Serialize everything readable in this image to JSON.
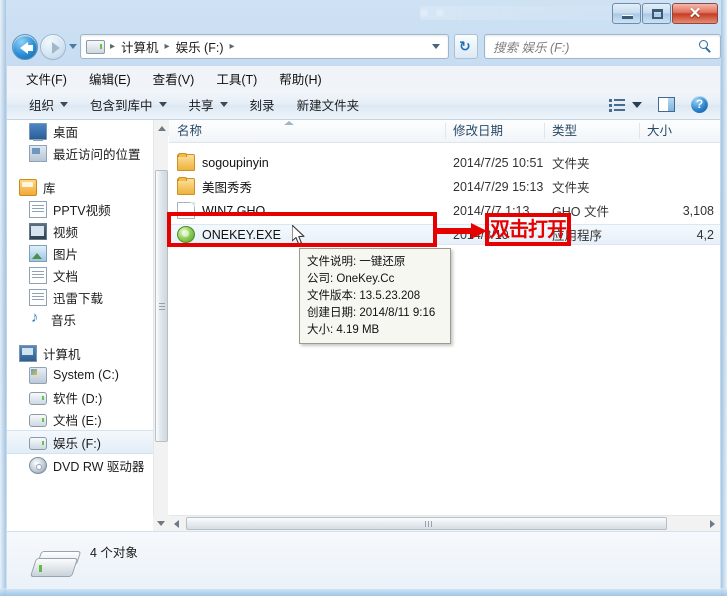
{
  "window": {
    "controls": {
      "minimize": "–",
      "maximize": "□",
      "close": "✕"
    }
  },
  "addressbar": {
    "crumbs": [
      "计算机",
      "娱乐 (F:)"
    ],
    "separator": "▸",
    "refresh_label": "↻"
  },
  "search": {
    "placeholder": "搜索 娱乐 (F:)"
  },
  "menubar": {
    "items": [
      {
        "label": "文件(F)"
      },
      {
        "label": "编辑(E)"
      },
      {
        "label": "查看(V)"
      },
      {
        "label": "工具(T)"
      },
      {
        "label": "帮助(H)"
      }
    ]
  },
  "toolbar": {
    "items": [
      {
        "label": "组织",
        "caret": true
      },
      {
        "label": "包含到库中",
        "caret": true
      },
      {
        "label": "共享",
        "caret": true
      },
      {
        "label": "刻录",
        "caret": false
      },
      {
        "label": "新建文件夹",
        "caret": false
      }
    ],
    "help_label": "?"
  },
  "navpane": {
    "items": [
      {
        "label": "桌面",
        "icon": "desktop-icon",
        "indent": true,
        "selected": false
      },
      {
        "label": "最近访问的位置",
        "icon": "recent-places-icon",
        "indent": true,
        "selected": false
      },
      {
        "label": "",
        "icon": "spacer",
        "indent": false,
        "selected": false
      },
      {
        "label": "库",
        "icon": "library-icon",
        "indent": false,
        "selected": false
      },
      {
        "label": "PPTV视频",
        "icon": "pptv-icon",
        "indent": true,
        "selected": false
      },
      {
        "label": "视频",
        "icon": "video-icon",
        "indent": true,
        "selected": false
      },
      {
        "label": "图片",
        "icon": "pictures-icon",
        "indent": true,
        "selected": false
      },
      {
        "label": "文档",
        "icon": "documents-icon",
        "indent": true,
        "selected": false
      },
      {
        "label": "迅雷下载",
        "icon": "thunder-download-icon",
        "indent": true,
        "selected": false
      },
      {
        "label": "音乐",
        "icon": "music-icon",
        "indent": true,
        "selected": false
      },
      {
        "label": "",
        "icon": "spacer",
        "indent": false,
        "selected": false
      },
      {
        "label": "计算机",
        "icon": "computer-icon",
        "indent": false,
        "selected": false
      },
      {
        "label": "System (C:)",
        "icon": "system-drive-icon",
        "indent": true,
        "selected": false
      },
      {
        "label": "软件 (D:)",
        "icon": "drive-icon",
        "indent": true,
        "selected": false
      },
      {
        "label": "文档 (E:)",
        "icon": "drive-icon",
        "indent": true,
        "selected": false
      },
      {
        "label": "娱乐 (F:)",
        "icon": "drive-icon",
        "indent": true,
        "selected": true
      },
      {
        "label": "DVD RW 驱动器",
        "icon": "dvd-drive-icon",
        "indent": true,
        "selected": false
      }
    ]
  },
  "filelist": {
    "columns": [
      {
        "key": "name",
        "label": "名称"
      },
      {
        "key": "date",
        "label": "修改日期"
      },
      {
        "key": "type",
        "label": "类型"
      },
      {
        "key": "size",
        "label": "大小"
      }
    ],
    "rows": [
      {
        "name": "sogoupinyin",
        "date": "2014/7/25 10:51",
        "type": "文件夹",
        "size": "",
        "icon": "folder-icon",
        "selected": false
      },
      {
        "name": "美图秀秀",
        "date": "2014/7/29 15:13",
        "type": "文件夹",
        "size": "",
        "icon": "folder-icon",
        "selected": false
      },
      {
        "name": "WIN7.GHO",
        "date": "2014/7/7 1:13",
        "type": "GHO 文件",
        "size": "3,108",
        "icon": "file-icon",
        "selected": false
      },
      {
        "name": "ONEKEY.EXE",
        "date": "2014/8/10",
        "type": "应用程序",
        "size": "4,2",
        "icon": "exe-icon",
        "selected": true
      }
    ]
  },
  "tooltip": {
    "lines": [
      "文件说明: 一键还原",
      "公司: OneKey.Cc",
      "文件版本: 13.5.23.208",
      "创建日期: 2014/8/11 9:16",
      "大小: 4.19 MB"
    ]
  },
  "statusbar": {
    "count": "4 个对象"
  },
  "annotation": {
    "label": "双击打开",
    "color": "#e60000"
  }
}
